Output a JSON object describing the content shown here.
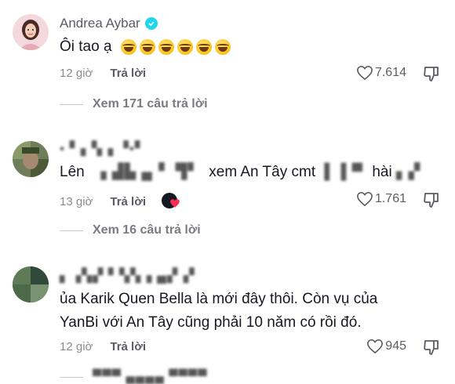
{
  "comments": [
    {
      "username": "Andrea Aybar",
      "verified": true,
      "text": "Ôi tao ạ",
      "emoji_count": 6,
      "time": "12 giờ",
      "reply_label": "Trả lời",
      "likes": "7.614",
      "view_replies": "Xem 171 câu trả lời"
    },
    {
      "username": "",
      "text_parts": [
        "Lên",
        "xem An Tây cmt",
        "hài"
      ],
      "time": "13 giờ",
      "reply_label": "Trả lời",
      "likes": "1.761",
      "view_replies": "Xem 16 câu trả lời"
    },
    {
      "username": "",
      "text_line1": "ủa Karik Quen Bella là mới đây thôi. Còn vụ của",
      "text_line2": "YanBi với An Tây cũng phải 10 năm có rồi đó.",
      "time": "12 giờ",
      "reply_label": "Trả lời",
      "likes": "945"
    }
  ],
  "icons": {
    "like": "heart-outline-icon",
    "dislike": "thumbs-down-icon",
    "verified": "verified-badge-icon",
    "creator_liked": "creator-liked-heart-icon"
  },
  "colors": {
    "verified": "#20d5ec",
    "heart_badge": "#fe2c55",
    "meta_text": "#8a8b91"
  }
}
